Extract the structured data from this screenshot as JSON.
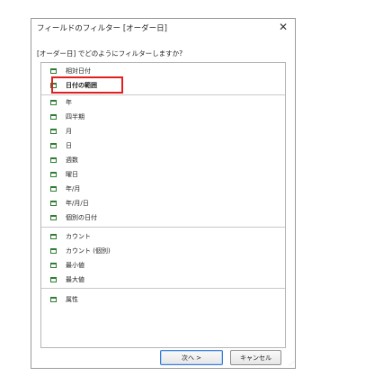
{
  "dialog": {
    "title": "フィールドのフィルター [オーダー日]",
    "prompt": "[オーダー日] でどのようにフィルターしますか?",
    "close_label": "✕"
  },
  "list": {
    "groups": [
      [
        "相対日付",
        "日付の範囲"
      ],
      [
        "年",
        "四半期",
        "月",
        "日",
        "週数",
        "曜日",
        "年/月",
        "年/月/日",
        "個別の日付"
      ],
      [
        "カウント",
        "カウント (個別)",
        "最小値",
        "最大値"
      ],
      [
        "属性"
      ]
    ],
    "highlighted_item": "日付の範囲"
  },
  "buttons": {
    "next_label": "次へ >",
    "cancel_label": "キャンセル"
  },
  "colors": {
    "highlight": "#e02020",
    "icon": "#2e7d32",
    "primary_border": "#3a7bd5"
  },
  "icons": {
    "item_icon": "calendar-icon",
    "close": "close-icon",
    "resize": "resize-grip-icon"
  }
}
